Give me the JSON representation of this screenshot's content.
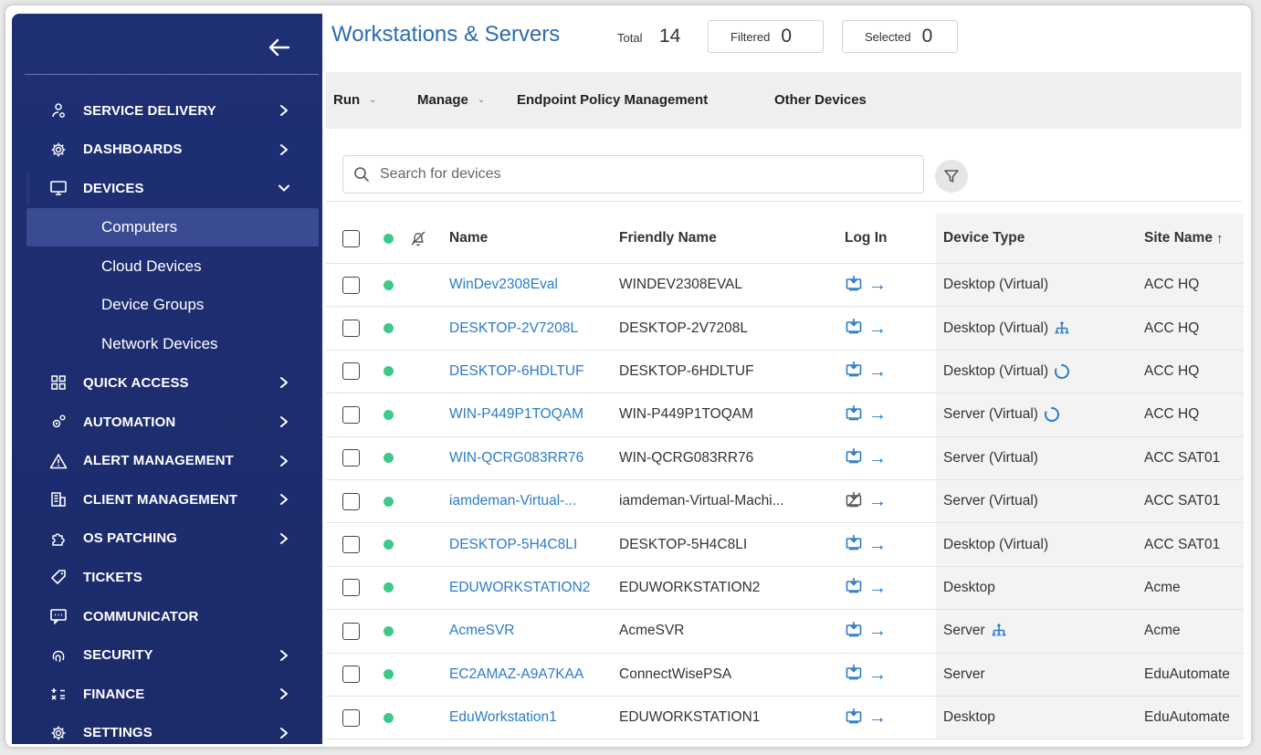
{
  "sidebar": {
    "items": [
      {
        "label": "SERVICE DELIVERY",
        "icon": "user-gear-icon",
        "has_chevron": true
      },
      {
        "label": "DASHBOARDS",
        "icon": "gear-icon",
        "has_chevron": true
      },
      {
        "label": "DEVICES",
        "icon": "monitor-icon",
        "has_chevron": true,
        "expanded": true
      },
      {
        "label": "QUICK ACCESS",
        "icon": "grid-icon",
        "has_chevron": true
      },
      {
        "label": "AUTOMATION",
        "icon": "gears-icon",
        "has_chevron": true
      },
      {
        "label": "ALERT MANAGEMENT",
        "icon": "warning-icon",
        "has_chevron": true
      },
      {
        "label": "CLIENT MANAGEMENT",
        "icon": "building-icon",
        "has_chevron": true
      },
      {
        "label": "OS PATCHING",
        "icon": "puzzle-icon",
        "has_chevron": true
      },
      {
        "label": "TICKETS",
        "icon": "tag-icon",
        "has_chevron": false
      },
      {
        "label": "COMMUNICATOR",
        "icon": "chat-icon",
        "has_chevron": false
      },
      {
        "label": "SECURITY",
        "icon": "fingerprint-icon",
        "has_chevron": true
      },
      {
        "label": "FINANCE",
        "icon": "calculator-icon",
        "has_chevron": true
      },
      {
        "label": "SETTINGS",
        "icon": "gear-icon",
        "has_chevron": true
      }
    ],
    "devices_sub": [
      "Computers",
      "Cloud Devices",
      "Device Groups",
      "Network Devices"
    ],
    "selected_sub": "Computers"
  },
  "header": {
    "title": "Workstations & Servers",
    "total_label": "Total",
    "total_value": "14",
    "filtered_label": "Filtered",
    "filtered_value": "0",
    "selected_label": "Selected",
    "selected_value": "0"
  },
  "toolbar": {
    "run_label": "Run",
    "manage_label": "Manage",
    "epm_label": "Endpoint Policy Management",
    "other_label": "Other Devices"
  },
  "search": {
    "placeholder": "Search for devices"
  },
  "table": {
    "columns": {
      "name": "Name",
      "friendly": "Friendly Name",
      "login": "Log In",
      "type": "Device Type",
      "site": "Site Name"
    },
    "rows": [
      {
        "name": "WinDev2308Eval",
        "friendly": "WINDEV2308EVAL",
        "type": "Desktop (Virtual)",
        "type_icon": "",
        "site": "ACC HQ",
        "login_disabled": false
      },
      {
        "name": "DESKTOP-2V7208L",
        "friendly": "DESKTOP-2V7208L",
        "type": "Desktop (Virtual)",
        "type_icon": "network-icon",
        "site": "ACC HQ",
        "login_disabled": false
      },
      {
        "name": "DESKTOP-6HDLTUF",
        "friendly": "DESKTOP-6HDLTUF",
        "type": "Desktop (Virtual)",
        "type_icon": "loading-icon",
        "site": "ACC HQ",
        "login_disabled": false
      },
      {
        "name": "WIN-P449P1TOQAM",
        "friendly": "WIN-P449P1TOQAM",
        "type": "Server (Virtual)",
        "type_icon": "loading-icon",
        "site": "ACC HQ",
        "login_disabled": false
      },
      {
        "name": "WIN-QCRG083RR76",
        "friendly": "WIN-QCRG083RR76",
        "type": "Server (Virtual)",
        "type_icon": "",
        "site": "ACC SAT01",
        "login_disabled": false
      },
      {
        "name": "iamdeman-Virtual-...",
        "friendly": "iamdeman-Virtual-Machi...",
        "type": "Server (Virtual)",
        "type_icon": "",
        "site": "ACC SAT01",
        "login_disabled": true
      },
      {
        "name": "DESKTOP-5H4C8LI",
        "friendly": "DESKTOP-5H4C8LI",
        "type": "Desktop (Virtual)",
        "type_icon": "",
        "site": "ACC SAT01",
        "login_disabled": false
      },
      {
        "name": "EDUWORKSTATION2",
        "friendly": "EDUWORKSTATION2",
        "type": "Desktop",
        "type_icon": "",
        "site": "Acme",
        "login_disabled": false
      },
      {
        "name": "AcmeSVR",
        "friendly": "AcmeSVR",
        "type": "Server",
        "type_icon": "network-icon",
        "site": "Acme",
        "login_disabled": false
      },
      {
        "name": "EC2AMAZ-A9A7KAA",
        "friendly": "ConnectWisePSA",
        "type": "Server",
        "type_icon": "",
        "site": "EduAutomate",
        "login_disabled": false
      },
      {
        "name": "EduWorkstation1",
        "friendly": "EDUWORKSTATION1",
        "type": "Desktop",
        "type_icon": "",
        "site": "EduAutomate",
        "login_disabled": false
      }
    ]
  },
  "colors": {
    "sidebar_bg": "#1f2f74",
    "link": "#2b7bc9",
    "online": "#3cc98a",
    "title": "#2b6cb0"
  }
}
